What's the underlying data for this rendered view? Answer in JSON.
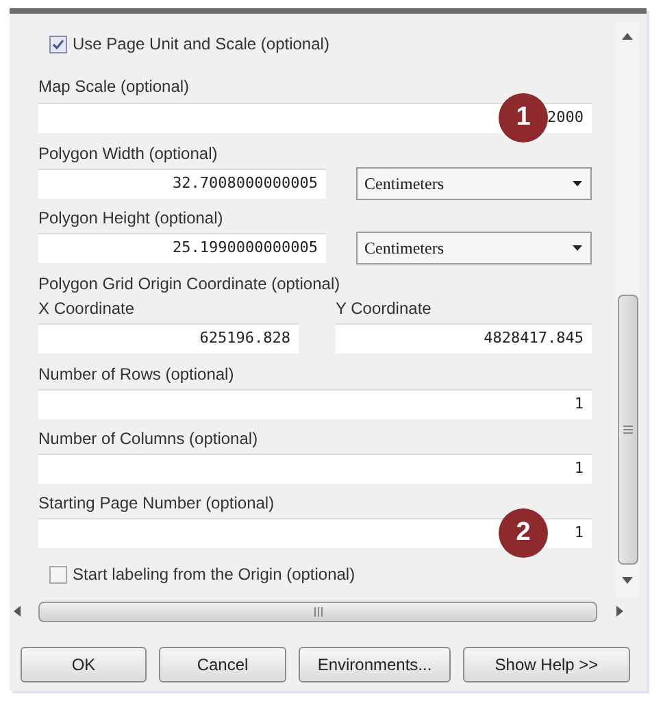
{
  "use_page_unit": {
    "label": "Use Page Unit and Scale (optional)",
    "checked": true
  },
  "map_scale": {
    "label": "Map Scale (optional)",
    "value": "2000"
  },
  "polygon_width": {
    "label": "Polygon Width (optional)",
    "value": "32.7008000000005",
    "unit": "Centimeters"
  },
  "polygon_height": {
    "label": "Polygon Height (optional)",
    "value": "25.1990000000005",
    "unit": "Centimeters"
  },
  "origin": {
    "label": "Polygon Grid Origin Coordinate (optional)",
    "x_label": "X Coordinate",
    "x_value": "625196.828",
    "y_label": "Y Coordinate",
    "y_value": "4828417.845"
  },
  "number_of_rows": {
    "label": "Number of Rows (optional)",
    "value": "1"
  },
  "number_of_columns": {
    "label": "Number of Columns (optional)",
    "value": "1"
  },
  "starting_page_number": {
    "label": "Starting Page Number (optional)",
    "value": "1"
  },
  "start_from_origin": {
    "label": "Start labeling from the Origin (optional)",
    "checked": false
  },
  "callouts": [
    {
      "number": "1"
    },
    {
      "number": "2"
    }
  ],
  "buttons": [
    {
      "label": "OK"
    },
    {
      "label": "Cancel"
    },
    {
      "label": "Environments..."
    },
    {
      "label": "Show Help >>"
    }
  ]
}
